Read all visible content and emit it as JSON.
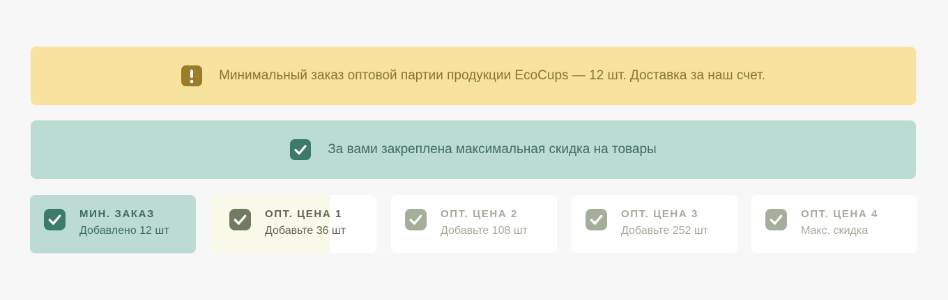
{
  "banners": {
    "warning": {
      "icon": "exclamation-icon",
      "text": "Минимальный заказ оптовой партии продукции EcoCups — 12 шт. Доставка за наш счет.",
      "bg_color": "#f7e39e",
      "text_color": "#8a7430"
    },
    "success": {
      "icon": "checkbox-checked-icon",
      "text": "За вами закреплена максимальная скидка на товары",
      "bg_color": "#badcd3",
      "text_color": "#3e6c61"
    }
  },
  "steps": [
    {
      "title": "МИН. ЗАКАЗ",
      "subtitle": "Добавлено 12 шт",
      "state": "completed",
      "icon": "checkbox-checked-icon"
    },
    {
      "title": "ОПТ. ЦЕНА 1",
      "subtitle": "Добавьте 36 шт",
      "state": "in-progress",
      "progress": 0.72,
      "icon": "checkbox-checked-icon"
    },
    {
      "title": "ОПТ. ЦЕНА 2",
      "subtitle": "Добавьте 108 шт",
      "state": "locked",
      "icon": "checkbox-checked-icon"
    },
    {
      "title": "ОПТ. ЦЕНА 3",
      "subtitle": "Добавьте 252 шт",
      "state": "locked",
      "icon": "checkbox-checked-icon"
    },
    {
      "title": "ОПТ. ЦЕНА 4",
      "subtitle": "Макс. скидка",
      "state": "locked",
      "icon": "checkbox-checked-icon"
    }
  ],
  "colors": {
    "page_bg": "#f7f7f7",
    "completed": "#3e7a68",
    "in_progress": "#737a63",
    "locked": "#a4ae98"
  }
}
